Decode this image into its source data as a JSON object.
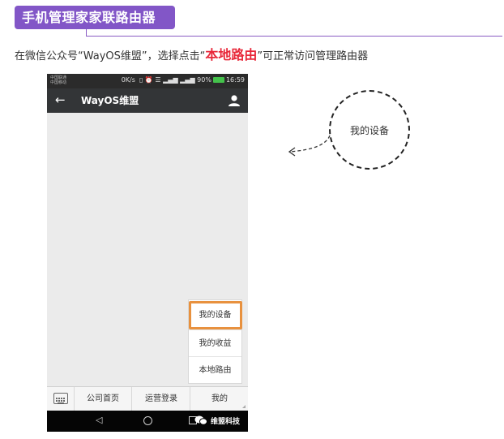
{
  "header": {
    "title": "手机管理家家联路由器"
  },
  "instruction": {
    "before": "在微信公众号“WayOS维盟”，选择点击“",
    "highlight": "本地路由",
    "after": "”可正常访问管理路由器"
  },
  "phone": {
    "status": {
      "carrier_line1": "中国联通",
      "carrier_line2": "中国移动",
      "speed": "0K/s",
      "battery": "90%",
      "time": "16:59"
    },
    "title": "WayOS维盟",
    "popup_menu": [
      "我的设备",
      "我的收益",
      "本地路由"
    ],
    "menu_tabs": [
      "公司首页",
      "运营登录",
      "我的"
    ],
    "watermark": "维盟科技"
  },
  "callout": {
    "label": "我的设备"
  },
  "colors": {
    "banner": "#8256c7",
    "highlight": "#e8283a",
    "focus_box": "#e8913e"
  }
}
